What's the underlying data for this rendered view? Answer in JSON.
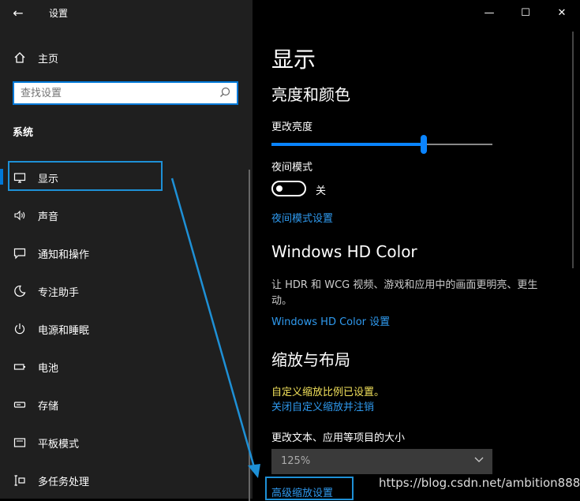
{
  "window": {
    "title": "设置",
    "minimize": "—",
    "maximize": "☐",
    "close": "✕"
  },
  "sidebar": {
    "home": "主页",
    "search_placeholder": "查找设置",
    "section": "系统",
    "items": [
      {
        "label": "显示",
        "icon": "monitor-icon"
      },
      {
        "label": "声音",
        "icon": "speaker-icon"
      },
      {
        "label": "通知和操作",
        "icon": "notification-icon"
      },
      {
        "label": "专注助手",
        "icon": "moon-icon"
      },
      {
        "label": "电源和睡眠",
        "icon": "power-icon"
      },
      {
        "label": "电池",
        "icon": "battery-icon"
      },
      {
        "label": "存储",
        "icon": "storage-icon"
      },
      {
        "label": "平板模式",
        "icon": "tablet-icon"
      },
      {
        "label": "多任务处理",
        "icon": "multitask-icon"
      }
    ]
  },
  "main": {
    "title": "显示",
    "brightness": {
      "heading": "亮度和颜色",
      "label": "更改亮度",
      "value": 0.69
    },
    "night_light": {
      "label": "夜间模式",
      "state": "关",
      "settings_link": "夜间模式设置"
    },
    "hd_color": {
      "heading": "Windows HD Color",
      "description": "让 HDR 和 WCG 视频、游戏和应用中的画面更明亮、更生动。",
      "link": "Windows HD Color 设置"
    },
    "scale": {
      "heading": "缩放与布局",
      "warning": "自定义缩放比例已设置。",
      "disable_link": "关闭自定义缩放并注销",
      "size_label": "更改文本、应用等项目的大小",
      "size_value": "125%",
      "advanced_link": "高级缩放设置"
    }
  },
  "watermark": "https://blog.csdn.net/ambition8888",
  "colors": {
    "accent": "#0078d7",
    "link": "#2f9aef",
    "warning": "#f1e05a",
    "annotation": "#1e90d6"
  }
}
